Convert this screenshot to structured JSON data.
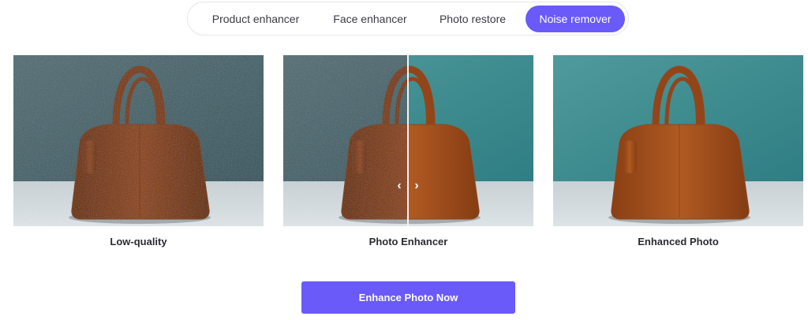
{
  "tabs": [
    {
      "label": "Product enhancer"
    },
    {
      "label": "Face enhancer"
    },
    {
      "label": "Photo restore"
    },
    {
      "label": "Noise remover",
      "active": true
    }
  ],
  "panels": [
    {
      "caption": "Low-quality"
    },
    {
      "caption": "Photo Enhancer"
    },
    {
      "caption": "Enhanced Photo"
    }
  ],
  "cta": {
    "label": "Enhance Photo Now"
  },
  "colors": {
    "accent": "#6a5af9",
    "bag_noisy": "#8c4a25",
    "bag_enhanced": "#a7521f",
    "wall_noisy": "#4f6b72",
    "wall_enhanced": "#3f8d91"
  },
  "icons": {
    "left": "chevron-left-icon",
    "right": "chevron-right-icon"
  }
}
